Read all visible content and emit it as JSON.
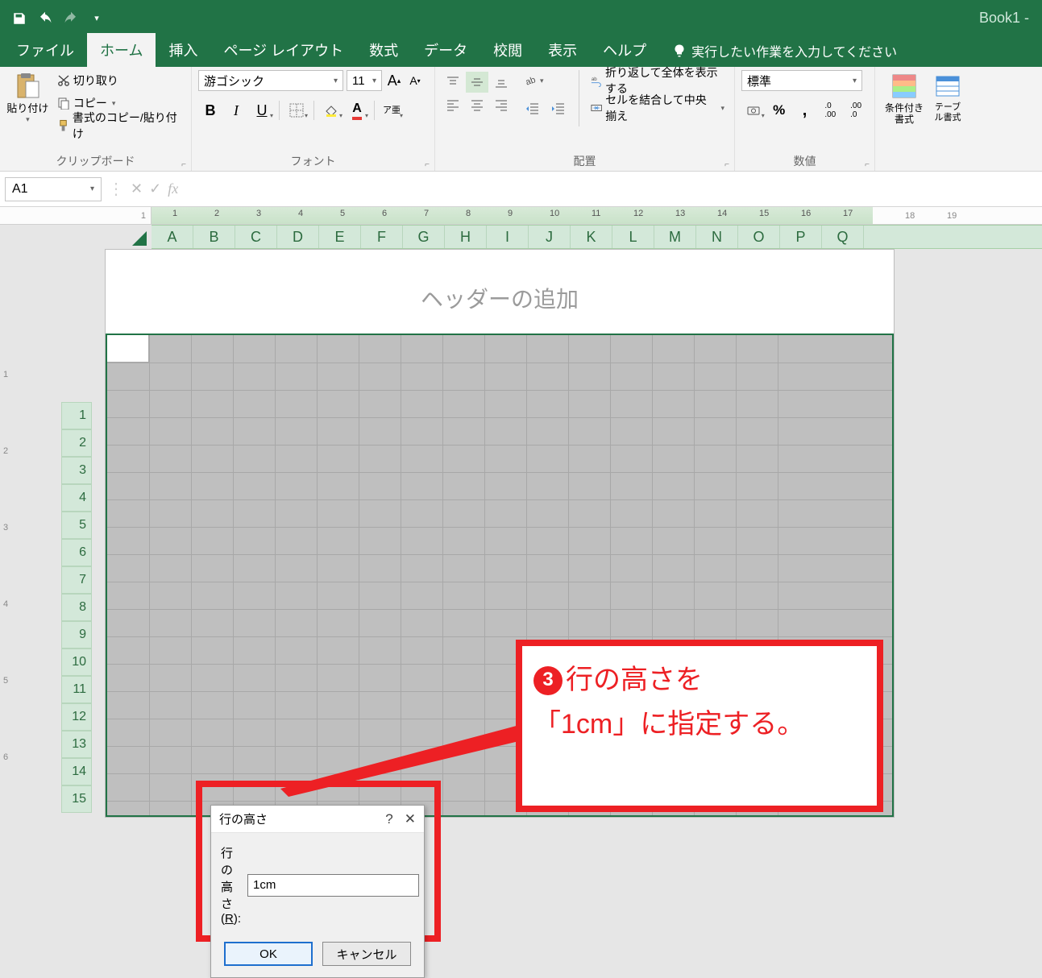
{
  "titlebar": {
    "book_name": "Book1  -"
  },
  "tabs": {
    "file": "ファイル",
    "home": "ホーム",
    "insert": "挿入",
    "page_layout": "ページ レイアウト",
    "formulas": "数式",
    "data": "データ",
    "review": "校閲",
    "view": "表示",
    "help": "ヘルプ",
    "tell_me": "実行したい作業を入力してください"
  },
  "ribbon": {
    "clipboard": {
      "label": "クリップボード",
      "paste": "貼り付け",
      "cut": "切り取り",
      "copy": "コピー",
      "format_painter": "書式のコピー/貼り付け"
    },
    "font": {
      "label": "フォント",
      "name": "游ゴシック",
      "size": "11",
      "grow": "A",
      "shrink": "A",
      "ruby": "ア亜"
    },
    "alignment": {
      "label": "配置",
      "wrap": "折り返して全体を表示する",
      "merge": "セルを結合して中央揃え"
    },
    "number": {
      "label": "数値",
      "format": "標準"
    },
    "styles": {
      "cond": "条件付き書式",
      "table": "テーブル書式"
    }
  },
  "namebar": {
    "cell": "A1",
    "fx": "fx"
  },
  "ruler_h_right": [
    "18",
    "19"
  ],
  "column_letters": [
    "A",
    "B",
    "C",
    "D",
    "E",
    "F",
    "G",
    "H",
    "I",
    "J",
    "K",
    "L",
    "M",
    "N",
    "O",
    "P",
    "Q"
  ],
  "row_numbers": [
    "1",
    "2",
    "3",
    "4",
    "5",
    "6",
    "7",
    "8",
    "9",
    "10",
    "11",
    "12",
    "13",
    "14",
    "15"
  ],
  "ruler_v": [
    "1",
    "2",
    "3",
    "4",
    "5",
    "6"
  ],
  "header_placeholder": "ヘッダーの追加",
  "dialog": {
    "title": "行の高さ",
    "field_label_pre": "行の高さ(",
    "field_key": "R",
    "field_label_post": "):",
    "value": "1cm",
    "ok": "OK",
    "cancel": "キャンセル",
    "help": "?",
    "close": "✕"
  },
  "callout": {
    "step": "3",
    "line1": "行の高さを",
    "line2": "「1cm」に指定する。"
  }
}
